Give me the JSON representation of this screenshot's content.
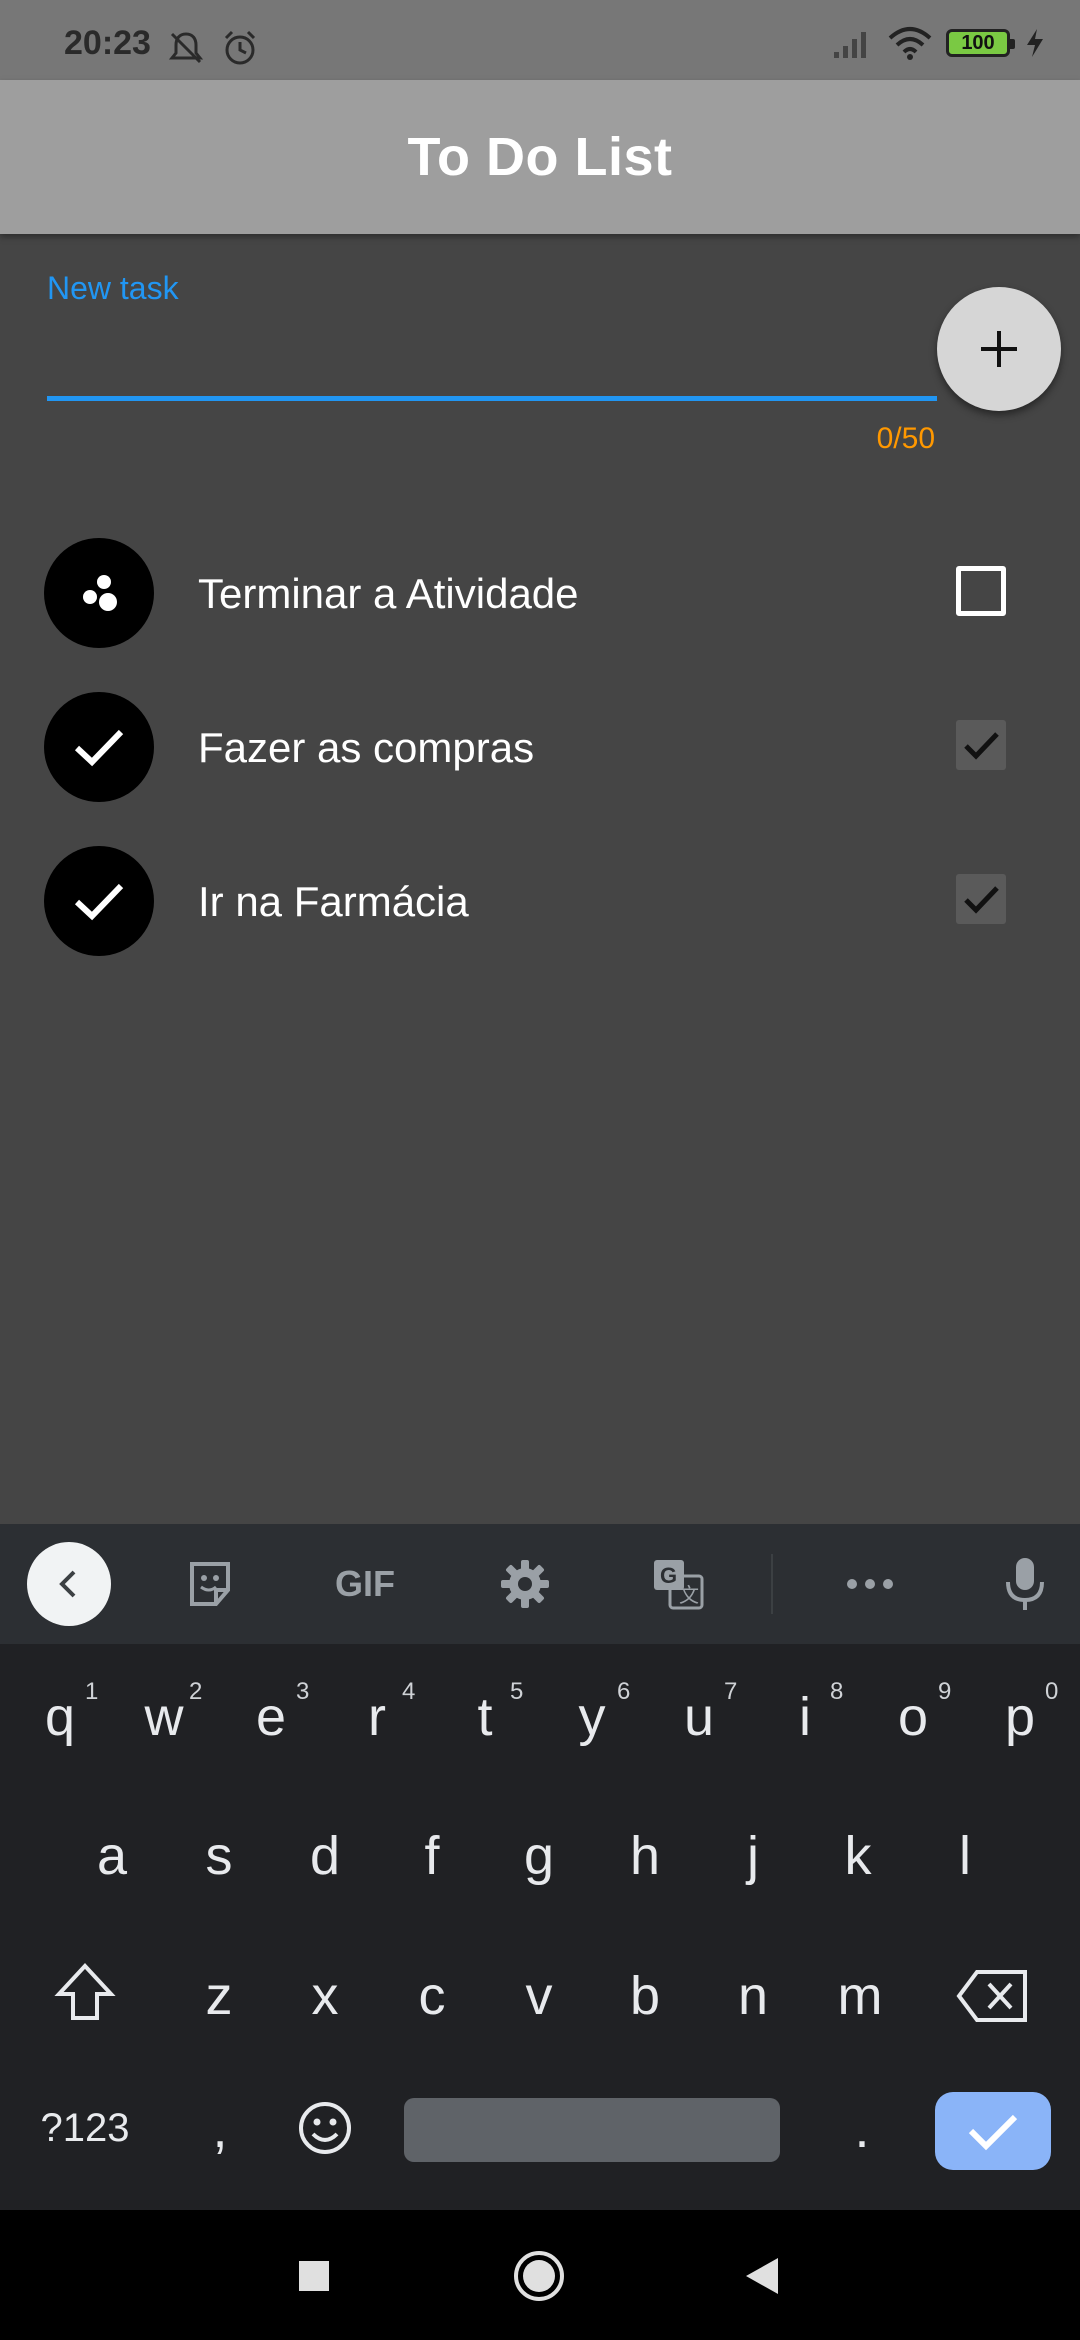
{
  "status_bar": {
    "time": "20:23",
    "battery": "100",
    "icons": [
      "mute-icon",
      "alarm-icon",
      "signal-icon",
      "wifi-icon",
      "battery-icon",
      "charging-icon"
    ]
  },
  "app_bar": {
    "title": "To Do List"
  },
  "new_task": {
    "label": "New task",
    "value": "",
    "counter": "0/50",
    "add_icon": "plus-icon"
  },
  "tasks": [
    {
      "text": "Terminar a Atividade",
      "done": false,
      "avatar_icon": "in-progress-icon"
    },
    {
      "text": "Fazer as compras",
      "done": true,
      "avatar_icon": "check-icon"
    },
    {
      "text": "Ir na Farmácia",
      "done": true,
      "avatar_icon": "check-icon"
    }
  ],
  "keyboard": {
    "toolbar": [
      "back-icon",
      "sticker-icon",
      "GIF",
      "settings-icon",
      "translate-icon",
      "more-icon",
      "mic-icon"
    ],
    "gif_label": "GIF",
    "row1": [
      "q",
      "w",
      "e",
      "r",
      "t",
      "y",
      "u",
      "i",
      "o",
      "p"
    ],
    "row1_hints": [
      "1",
      "2",
      "3",
      "4",
      "5",
      "6",
      "7",
      "8",
      "9",
      "0"
    ],
    "row2": [
      "a",
      "s",
      "d",
      "f",
      "g",
      "h",
      "j",
      "k",
      "l"
    ],
    "row3": [
      "z",
      "x",
      "c",
      "v",
      "b",
      "n",
      "m"
    ],
    "symbols_label": "?123",
    "comma": ",",
    "period": "."
  },
  "colors": {
    "accent": "#2196f3",
    "counter": "#ff9800",
    "background": "#454545",
    "app_bar": "#9e9e9e"
  }
}
